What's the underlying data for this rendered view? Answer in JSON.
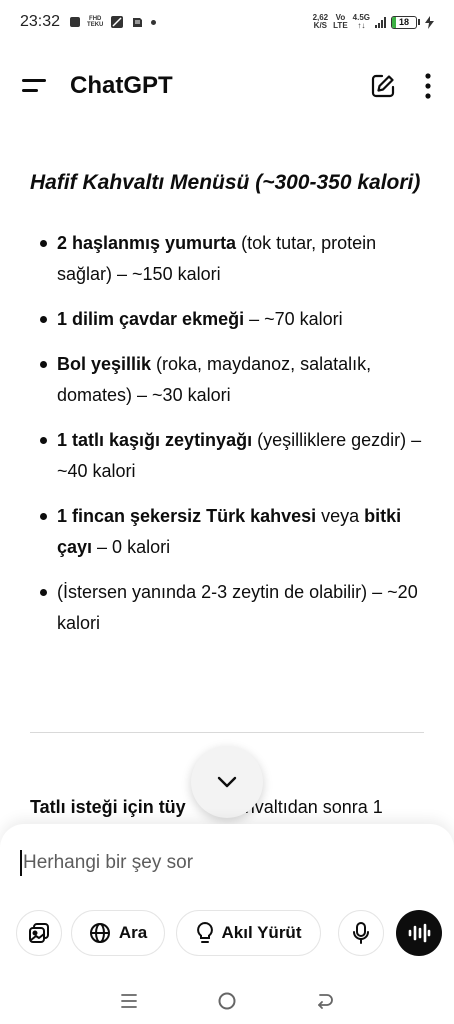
{
  "status_bar": {
    "time": "23:32",
    "net_speed": "2,62",
    "net_unit": "K/S",
    "vo": "Vo",
    "lte": "LTE",
    "network": "4.5G",
    "battery": "18",
    "battery_level": 0.18,
    "mini_icon_text": "FHD\nTEKU"
  },
  "app_bar": {
    "title": "ChatGPT"
  },
  "message": {
    "heading": "Hafif Kahvaltı Menüsü (~300-350 kalori)",
    "items": [
      {
        "bold": "2 haşlanmış yumurta",
        "rest": " (tok tutar, protein sağlar) – ~150 kalori"
      },
      {
        "bold": "1 dilim çavdar ekmeği",
        "rest": " – ~70 kalori"
      },
      {
        "bold": "Bol yeşillik",
        "rest": " (roka, maydanoz, salatalık, domates) – ~30 kalori"
      },
      {
        "bold": "1 tatlı kaşığı zeytinyağı",
        "rest": " (yeşilliklere gezdir) – ~40 kalori"
      },
      {
        "bold": "1 fincan şekersiz Türk kahvesi",
        "mid": " veya ",
        "bold2": "bitki çayı",
        "rest": " – 0 kalori"
      },
      {
        "bold": "",
        "rest": "(İstersen yanında 2-3 zeytin de olabilir) – ~20 kalori"
      }
    ],
    "partial_bold": "Tatlı isteği için tüy",
    "partial_rest": "kahvaltıdan sonra 1"
  },
  "composer": {
    "placeholder": "Herhangi bir şey sor",
    "search_label": "Ara",
    "reason_label": "Akıl Yürüt"
  },
  "icons": {
    "menu": "menu-icon",
    "new_chat": "edit-icon",
    "more": "more-vertical-icon",
    "scroll_down": "chevron-down-icon",
    "attach": "image-icon",
    "search": "globe-icon",
    "reason": "lightbulb-icon",
    "mic": "microphone-icon",
    "voice": "voice-wave-icon"
  },
  "colors": {
    "text": "#0d0d0d",
    "placeholder": "#5d5d5d",
    "battery": "#3cb043",
    "voice_button": "#0d0d0d"
  }
}
